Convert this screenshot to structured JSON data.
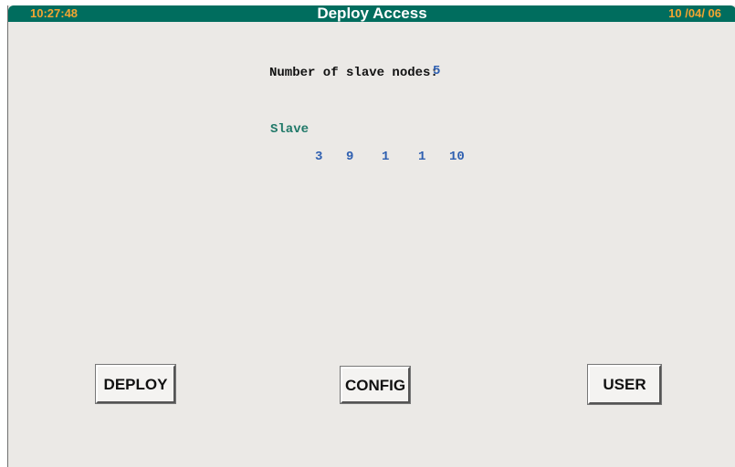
{
  "header": {
    "time": "10:27:48",
    "title": "Deploy Access",
    "date": "10 /04/ 06"
  },
  "slave_nodes": {
    "label": "Number of slave nodes:",
    "count": "5",
    "heading": "Slave",
    "values": [
      "3",
      "9",
      "1",
      "1",
      "10"
    ]
  },
  "buttons": {
    "deploy": "DEPLOY",
    "config": "CONFIG",
    "user": "USER"
  },
  "colors": {
    "title_bar": "#006d5e",
    "clock_text": "#f3a531",
    "value_text": "#2e5fb0",
    "heading_text": "#1f7868",
    "background": "#ebe9e6"
  }
}
